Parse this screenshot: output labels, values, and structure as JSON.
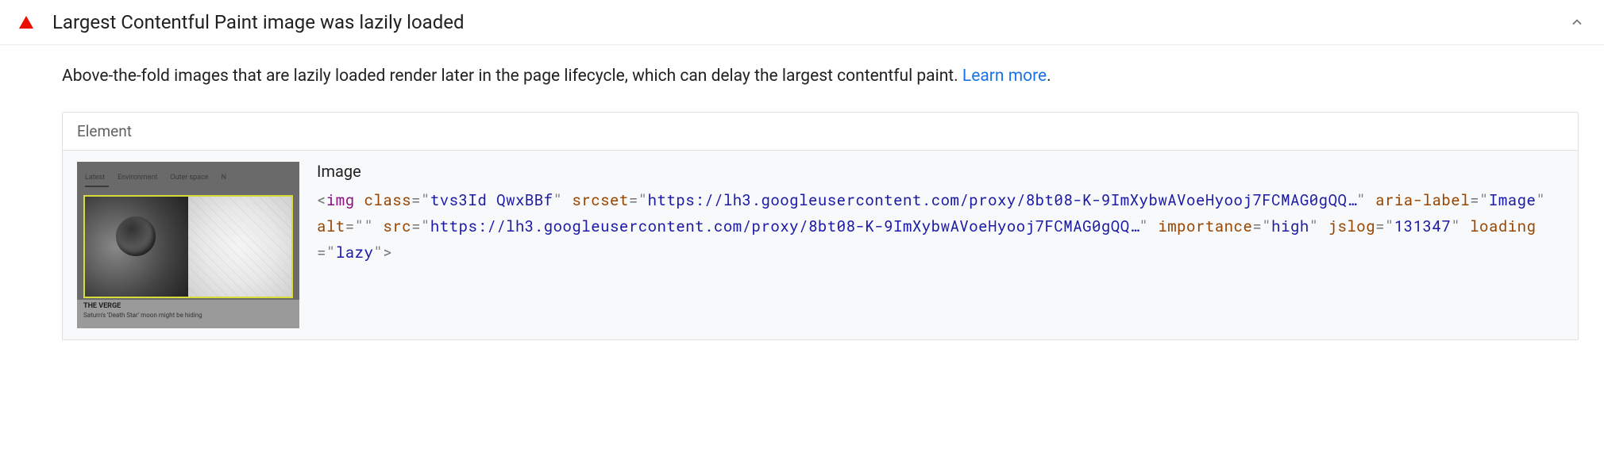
{
  "audit": {
    "title": "Largest Contentful Paint image was lazily loaded",
    "description_text": "Above-the-fold images that are lazily loaded render later in the page lifecycle, which can delay the largest contentful paint. ",
    "learn_more": "Learn more",
    "period": "."
  },
  "table": {
    "header": "Element",
    "row": {
      "label": "Image",
      "thumbnail": {
        "tabs": [
          "Latest",
          "Environment",
          "Outer space",
          "N"
        ],
        "source": "THE VERGE",
        "caption": "Saturn's 'Death Star' moon might be hiding"
      },
      "code": {
        "tag_open": "<",
        "tag_name": "img",
        "tag_close": ">",
        "attrs": [
          {
            "name": "class",
            "value": "tvs3Id QwxBBf"
          },
          {
            "name": "srcset",
            "value": "https://lh3.googleusercontent.com/proxy/8bt08-K-9ImXybwAVoeHyooj7FCMAG0gQQ…"
          },
          {
            "name": "aria-label",
            "value": "Image"
          },
          {
            "name": "alt",
            "value": ""
          },
          {
            "name": "src",
            "value": "https://lh3.googleusercontent.com/proxy/8bt08-K-9ImXybwAVoeHyooj7FCMAG0gQQ…"
          },
          {
            "name": "importance",
            "value": "high"
          },
          {
            "name": "jslog",
            "value": "131347"
          },
          {
            "name": "loading",
            "value": "lazy"
          }
        ]
      }
    }
  }
}
